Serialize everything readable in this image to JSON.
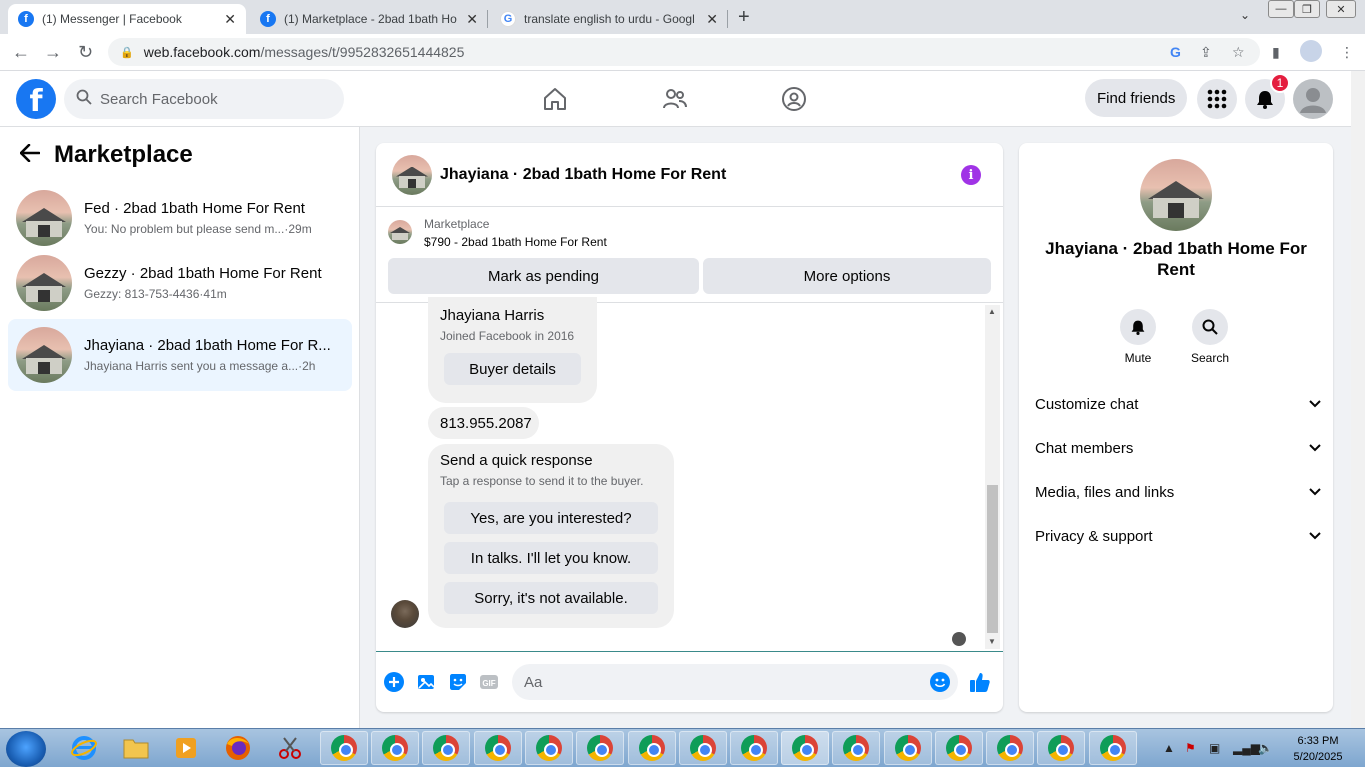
{
  "browser": {
    "tabs": [
      {
        "title": "(1) Messenger | Facebook",
        "icon": "facebook-icon",
        "active": true
      },
      {
        "title": "(1) Marketplace - 2bad 1bath Ho",
        "icon": "facebook-icon",
        "active": false
      },
      {
        "title": "translate english to urdu - Googl",
        "icon": "google-icon",
        "active": false
      }
    ],
    "url_host": "web.facebook.com",
    "url_path": "/messages/t/9952832651444825"
  },
  "fb": {
    "search_placeholder": "Search Facebook",
    "find_friends": "Find friends",
    "notification_count": "1"
  },
  "sidebar": {
    "title": "Marketplace",
    "conversations": [
      {
        "name": "Fed · 2bad 1bath Home For Rent",
        "preview": "You: No problem but please send m...",
        "time": " ·29m"
      },
      {
        "name": "Gezzy · 2bad 1bath Home For Rent",
        "preview": "Gezzy: 813-753-4436",
        "time": " ·41m"
      },
      {
        "name": "Jhayiana · 2bad 1bath Home For R...",
        "preview": "Jhayiana Harris sent you a message a...",
        "time": " ·2h"
      }
    ]
  },
  "chat": {
    "title": "Jhayiana · 2bad 1bath Home For Rent",
    "listing_label": "Marketplace",
    "listing_title": "$790 - 2bad 1bath Home For Rent",
    "mark_pending": "Mark as pending",
    "more_options": "More options",
    "buyer_name": "Jhayiana Harris",
    "buyer_joined": "Joined Facebook in 2016",
    "buyer_details": "Buyer details",
    "phone_message": "813.955.2087",
    "quick_title": "Send a quick response",
    "quick_sub": "Tap a response to send it to the buyer.",
    "quick_responses": [
      "Yes, are you interested?",
      "In talks. I'll let you know.",
      "Sorry, it's not available."
    ],
    "input_placeholder": "Aa"
  },
  "info": {
    "name": "Jhayiana · 2bad 1bath Home For Rent",
    "mute": "Mute",
    "search": "Search",
    "rows": [
      "Customize chat",
      "Chat members",
      "Media, files and links",
      "Privacy & support"
    ]
  },
  "taskbar": {
    "time": "6:33 PM",
    "date": "5/20/2025"
  },
  "colors": {
    "fb_blue": "#1877f2",
    "info_purple": "#a033e6",
    "active_conv": "#ebf5ff",
    "badge_red": "#e41e3f"
  }
}
